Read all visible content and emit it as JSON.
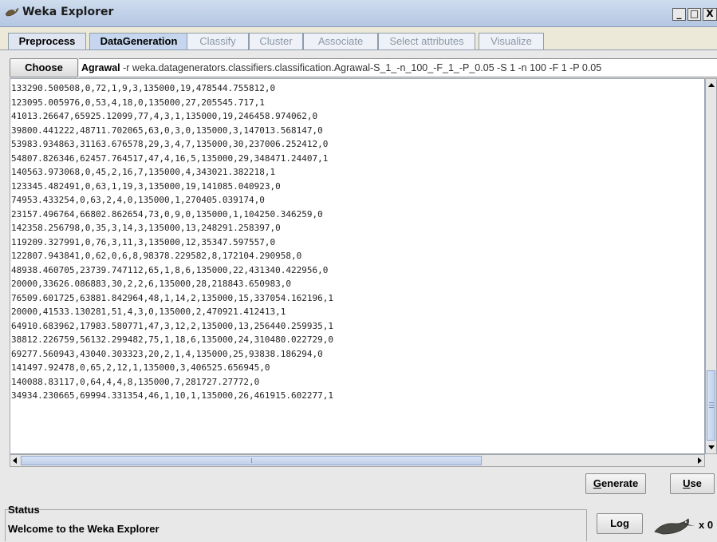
{
  "window": {
    "title": "Weka Explorer",
    "minimize_label": "_",
    "maximize_label": "□",
    "close_label": "X"
  },
  "tabs": [
    {
      "label": "Preprocess"
    },
    {
      "label": "DataGeneration"
    },
    {
      "label": "Classify"
    },
    {
      "label": "Cluster"
    },
    {
      "label": "Associate"
    },
    {
      "label": "Select attributes"
    },
    {
      "label": "Visualize"
    }
  ],
  "generator": {
    "choose_label": "Choose",
    "name": "Agrawal",
    "options": "-r weka.datagenerators.classifiers.classification.Agrawal-S_1_-n_100_-F_1_-P_0.05 -S 1 -n 100 -F 1 -P 0.05"
  },
  "output": {
    "lines": [
      "133290.500508,0,72,1,9,3,135000,19,478544.755812,0",
      "123095.005976,0,53,4,18,0,135000,27,205545.717,1",
      "41013.26647,65925.12099,77,4,3,1,135000,19,246458.974062,0",
      "39800.441222,48711.702065,63,0,3,0,135000,3,147013.568147,0",
      "53983.934863,31163.676578,29,3,4,7,135000,30,237006.252412,0",
      "54807.826346,62457.764517,47,4,16,5,135000,29,348471.24407,1",
      "140563.973068,0,45,2,16,7,135000,4,343021.382218,1",
      "123345.482491,0,63,1,19,3,135000,19,141085.040923,0",
      "74953.433254,0,63,2,4,0,135000,1,270405.039174,0",
      "23157.496764,66802.862654,73,0,9,0,135000,1,104250.346259,0",
      "142358.256798,0,35,3,14,3,135000,13,248291.258397,0",
      "119209.327991,0,76,3,11,3,135000,12,35347.597557,0",
      "122807.943841,0,62,0,6,8,98378.229582,8,172104.290958,0",
      "48938.460705,23739.747112,65,1,8,6,135000,22,431340.422956,0",
      "20000,33626.086883,30,2,2,6,135000,28,218843.650983,0",
      "76509.601725,63881.842964,48,1,14,2,135000,15,337054.162196,1",
      "20000,41533.130281,51,4,3,0,135000,2,470921.412413,1",
      "64910.683962,17983.580771,47,3,12,2,135000,13,256440.259935,1",
      "38812.226759,56132.299482,75,1,18,6,135000,24,310480.022729,0",
      "69277.560943,43040.303323,20,2,1,4,135000,25,93838.186294,0",
      "141497.92478,0,65,2,12,1,135000,3,406525.656945,0",
      "140088.83117,0,64,4,4,8,135000,7,281727.27772,0",
      "34934.230665,69994.331354,46,1,10,1,135000,26,461915.602277,1"
    ]
  },
  "buttons": {
    "generate_prefix": "G",
    "generate_rest": "enerate",
    "use_prefix": "U",
    "use_rest": "se",
    "log_label": "Log"
  },
  "status": {
    "label": "Status",
    "text": "Welcome to the Weka Explorer",
    "task_count": "x 0"
  },
  "colors": {
    "active_tab": "#c6d6ee",
    "scroll_thumb": "#bfd0ec"
  }
}
